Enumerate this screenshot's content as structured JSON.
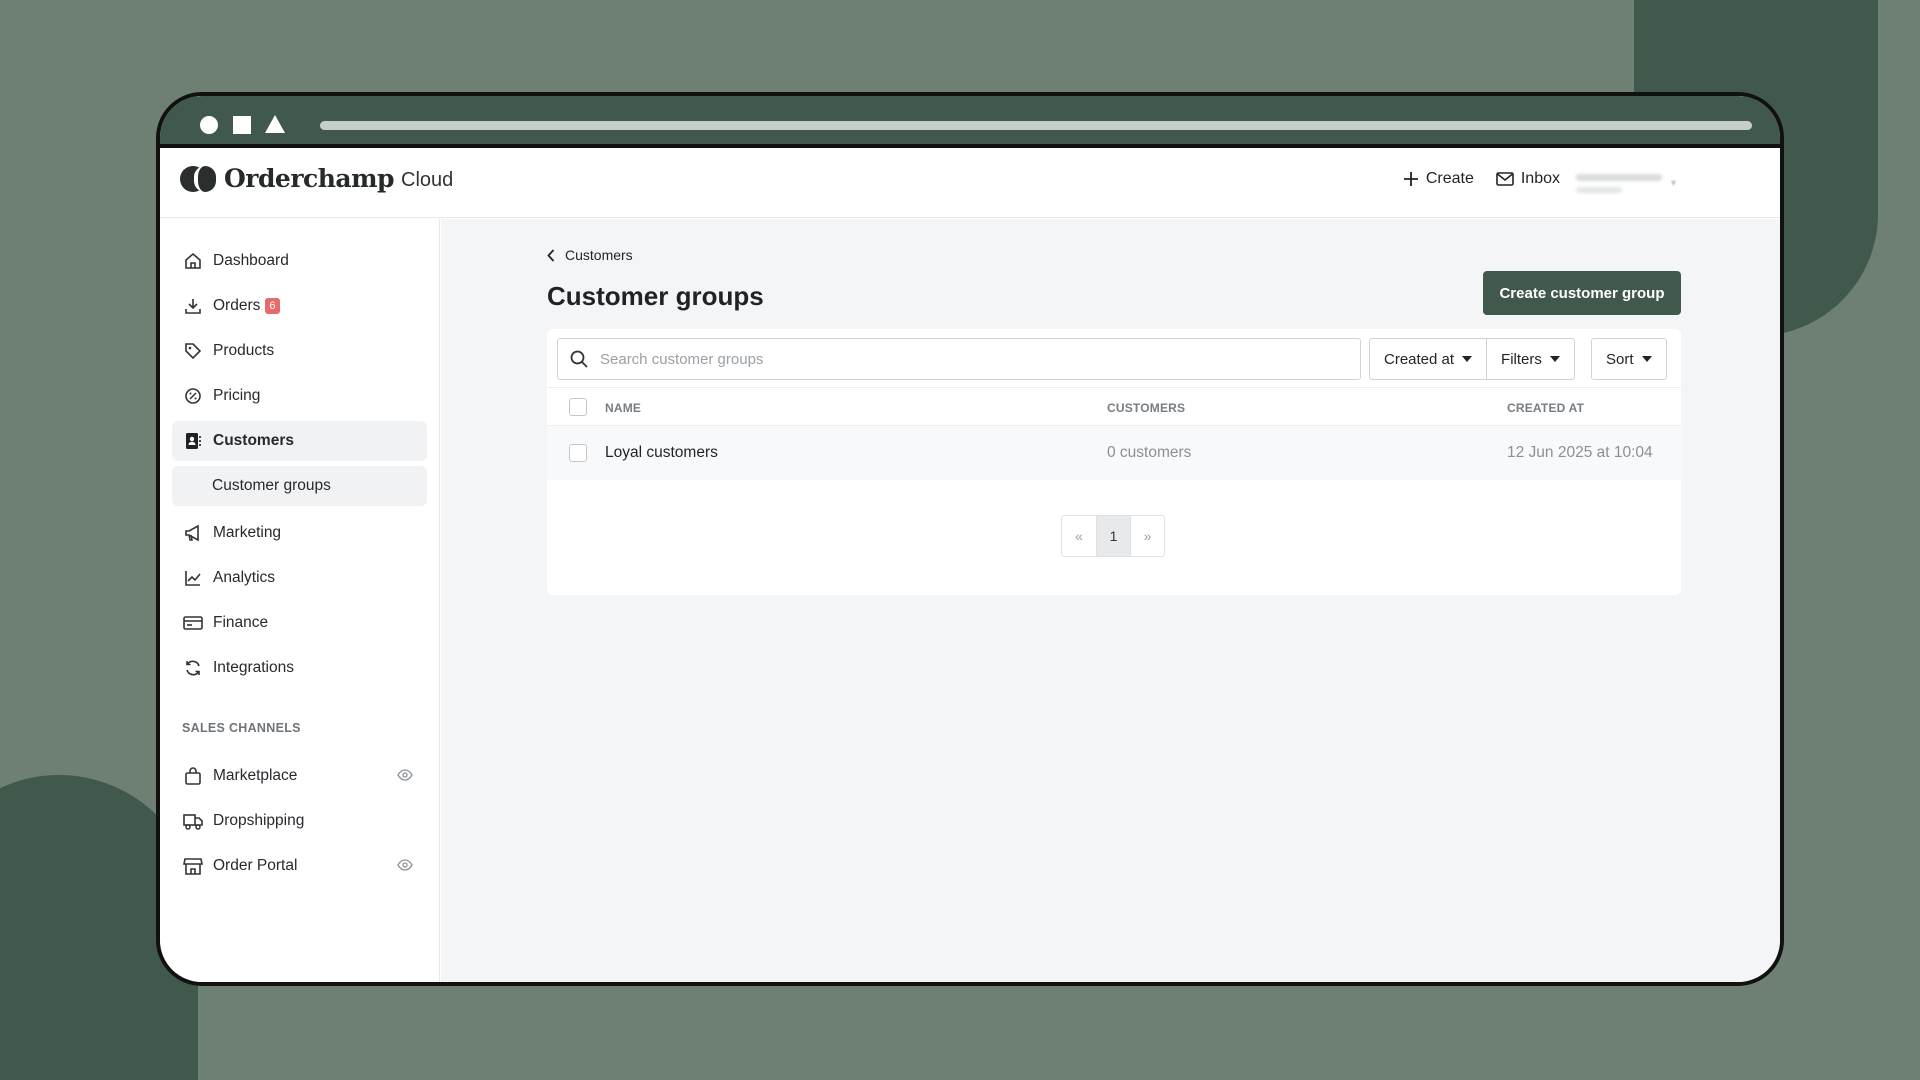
{
  "brand": {
    "name": "Orderchamp",
    "suffix": "Cloud"
  },
  "header": {
    "create_label": "Create",
    "inbox_label": "Inbox"
  },
  "sidebar": {
    "items": [
      {
        "label": "Dashboard",
        "icon": "home-icon"
      },
      {
        "label": "Orders",
        "icon": "download-tray-icon",
        "badge": "6"
      },
      {
        "label": "Products",
        "icon": "tag-icon"
      },
      {
        "label": "Pricing",
        "icon": "percent-badge-icon"
      },
      {
        "label": "Customers",
        "icon": "contact-book-icon"
      },
      {
        "label": "Customer groups"
      },
      {
        "label": "Marketing",
        "icon": "megaphone-icon"
      },
      {
        "label": "Analytics",
        "icon": "line-chart-icon"
      },
      {
        "label": "Finance",
        "icon": "credit-card-icon"
      },
      {
        "label": "Integrations",
        "icon": "sync-icon"
      }
    ],
    "section_label": "SALES CHANNELS",
    "channels": [
      {
        "label": "Marketplace",
        "icon": "shopping-bag-icon",
        "eye": true
      },
      {
        "label": "Dropshipping",
        "icon": "truck-icon",
        "eye": false
      },
      {
        "label": "Order Portal",
        "icon": "storefront-icon",
        "eye": true
      }
    ]
  },
  "main": {
    "breadcrumb": "Customers",
    "title": "Customer groups",
    "primary_button": "Create customer group",
    "search_placeholder": "Search customer groups",
    "filters": {
      "created_at": "Created at",
      "filters": "Filters",
      "sort": "Sort"
    },
    "table": {
      "columns": [
        "NAME",
        "CUSTOMERS",
        "CREATED AT"
      ],
      "rows": [
        {
          "name": "Loyal customers",
          "customers": "0 customers",
          "created_at": "12 Jun 2025 at 10:04"
        }
      ]
    },
    "pagination": {
      "prev": "«",
      "current": "1",
      "next": "»"
    }
  },
  "colors": {
    "accent": "#41594c",
    "background": "#6e8073",
    "badge": "#e66b6b"
  }
}
